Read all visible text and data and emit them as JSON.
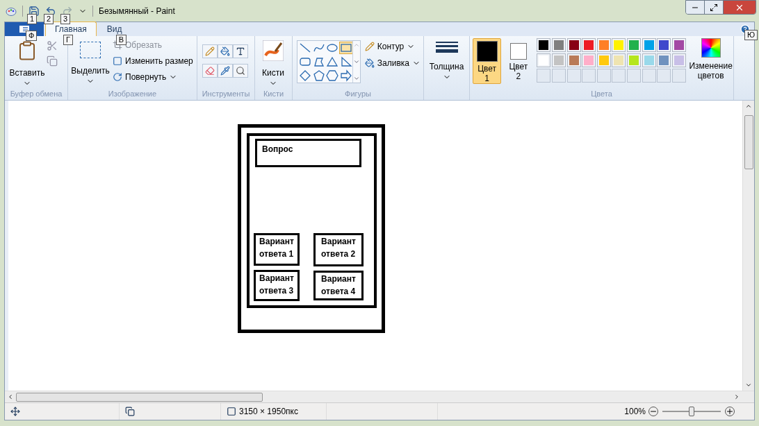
{
  "title_bar": {
    "title": "Безымянный - Paint",
    "quick_access": [
      {
        "kind": "save",
        "keytip": "1",
        "disabled": false
      },
      {
        "kind": "undo",
        "keytip": "2",
        "disabled": false
      },
      {
        "kind": "redo",
        "keytip": "3",
        "disabled": true
      }
    ]
  },
  "ribbon_tabs": {
    "file_keytip": "Ф",
    "tabs": [
      {
        "label": "Главная",
        "keytip": "Г",
        "selected": true
      },
      {
        "label": "Вид",
        "keytip": "В",
        "selected": false
      }
    ],
    "help_keytip": "Ю"
  },
  "clipboard": {
    "paste": "Вставить",
    "label": "Буфер обмена"
  },
  "image": {
    "select": "Выделить",
    "crop": {
      "label": "Обрезать",
      "disabled": true
    },
    "resize": "Изменить размер",
    "rotate": "Повернуть",
    "label": "Изображение"
  },
  "tools": {
    "label": "Инструменты"
  },
  "brushes": {
    "button": "Кисти",
    "label": "Кисти"
  },
  "shapes": {
    "items": [
      {
        "kind": "line",
        "selected": false
      },
      {
        "kind": "curve",
        "selected": false
      },
      {
        "kind": "oval",
        "selected": false
      },
      {
        "kind": "rectangle",
        "selected": true
      },
      {
        "kind": "rounded-rectangle",
        "selected": false
      },
      {
        "kind": "polygon",
        "selected": false
      },
      {
        "kind": "triangle",
        "selected": false
      },
      {
        "kind": "right-triangle",
        "selected": false
      },
      {
        "kind": "diamond",
        "selected": false
      },
      {
        "kind": "pentagon",
        "selected": false
      },
      {
        "kind": "hexagon",
        "selected": false
      },
      {
        "kind": "arrow",
        "selected": false
      }
    ],
    "outline": "Контур",
    "fill": "Заливка",
    "label": "Фигуры"
  },
  "size": {
    "label": "Толщина"
  },
  "colors": {
    "color1": {
      "label": "Цвет",
      "number": "1",
      "color": "#000000",
      "selected": true
    },
    "color2": {
      "label": "Цвет",
      "number": "2",
      "color": "#ffffff",
      "selected": false
    },
    "palette": [
      {
        "color": "#000000"
      },
      {
        "color": "#7f7f7f"
      },
      {
        "color": "#880015"
      },
      {
        "color": "#ed1c24"
      },
      {
        "color": "#ff7f27"
      },
      {
        "color": "#fff200"
      },
      {
        "color": "#22b14c"
      },
      {
        "color": "#00a2e8"
      },
      {
        "color": "#3f48cc"
      },
      {
        "color": "#a349a4"
      },
      {
        "color": "#ffffff"
      },
      {
        "color": "#c3c3c3"
      },
      {
        "color": "#b97a57"
      },
      {
        "color": "#ffaec9"
      },
      {
        "color": "#ffc90e"
      },
      {
        "color": "#efe4b0"
      },
      {
        "color": "#b5e61d"
      },
      {
        "color": "#99d9ea"
      },
      {
        "color": "#7092be"
      },
      {
        "color": "#c8bfe7"
      }
    ],
    "edit": "Изменение цветов",
    "label": "Цвета"
  },
  "canvas": {
    "question": "Вопрос",
    "answers": [
      "Вариант\nответа 1",
      "Вариант\nответа 2",
      "Вариант\nответа 3",
      "Вариант\nответа 4"
    ]
  },
  "status_bar": {
    "size": "3150 × 1950пкс",
    "zoom": "100%",
    "zoom_slider": {
      "level": 0.5
    }
  }
}
